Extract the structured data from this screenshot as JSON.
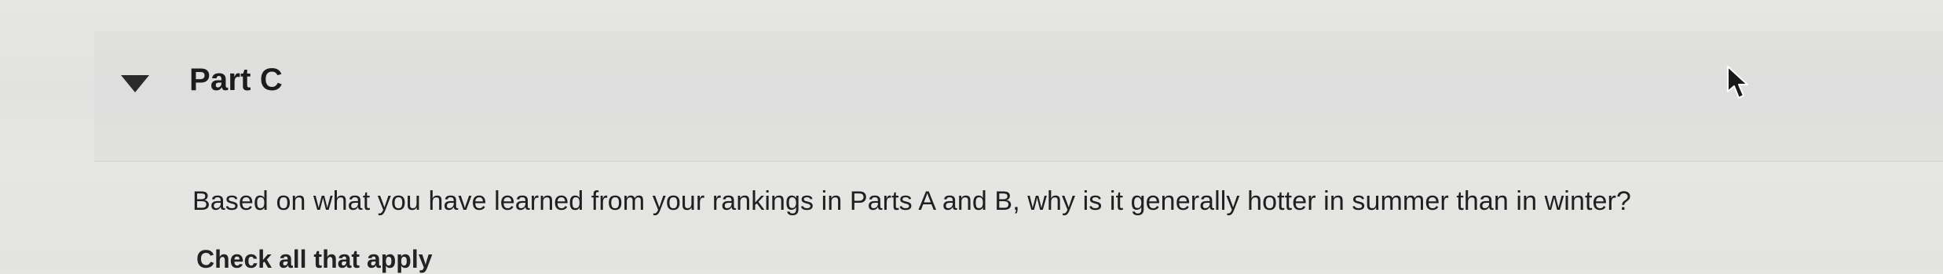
{
  "part": {
    "title": "Part C",
    "toggle_icon": "caret-down-icon",
    "expanded": true
  },
  "question": {
    "prompt": "Based on what you have learned from your rankings in Parts A and B, why is it generally hotter in summer than in winter?",
    "instruction": "Check all that apply"
  },
  "cursor": {
    "icon": "mouse-pointer-icon"
  },
  "colors": {
    "background": "#e4e4e2",
    "header_band": "#dfdfdd",
    "text": "#1f1f1f"
  }
}
